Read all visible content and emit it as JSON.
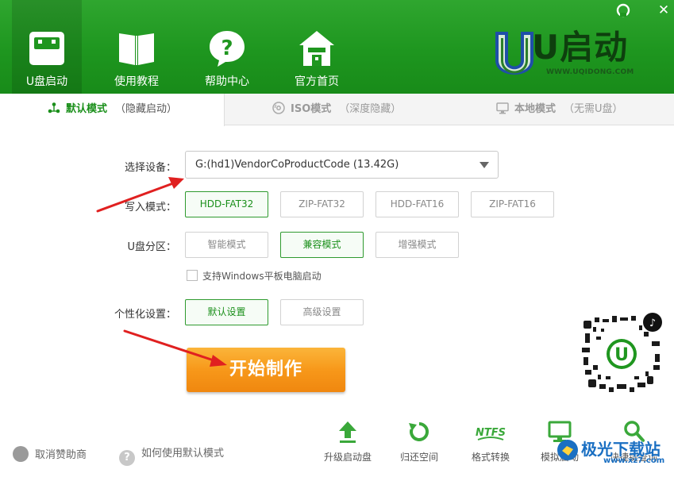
{
  "window": {
    "min_icon": "minimize-icon",
    "close_icon": "close-icon",
    "close_glyph": "✕"
  },
  "nav": [
    {
      "label": "U盘启动",
      "icon": "usb-drive-icon",
      "active": true
    },
    {
      "label": "使用教程",
      "icon": "book-icon",
      "active": false
    },
    {
      "label": "帮助中心",
      "icon": "help-icon",
      "active": false
    },
    {
      "label": "官方首页",
      "icon": "home-icon",
      "active": false
    }
  ],
  "logo": {
    "text": "U启动",
    "url": "WWW.UQIDONG.COM"
  },
  "tabs": [
    {
      "name": "默认模式",
      "sub": "（隐藏启动）",
      "icon": "share-nodes-icon"
    },
    {
      "name": "ISO模式",
      "sub": "（深度隐藏）",
      "icon": "disc-icon"
    },
    {
      "name": "本地模式",
      "sub": "（无需U盘）",
      "icon": "monitor-icon"
    }
  ],
  "form": {
    "device_label": "选择设备：",
    "device_value": "G:(hd1)VendorCoProductCode (13.42G)",
    "write_mode_label": "写入模式：",
    "write_modes": [
      "HDD-FAT32",
      "ZIP-FAT32",
      "HDD-FAT16",
      "ZIP-FAT16"
    ],
    "partition_label": "U盘分区：",
    "partitions": [
      "智能模式",
      "兼容模式",
      "增强模式"
    ],
    "tablet_checkbox_label": "支持Windows平板电脑启动",
    "personalize_label": "个性化设置：",
    "personalize_options": [
      "默认设置",
      "高级设置"
    ],
    "start_button": "开始制作"
  },
  "footer": {
    "cancel_sponsor": "取消赞助商",
    "how_to_use": "如何使用默认模式",
    "tools": [
      {
        "label": "升级启动盘",
        "icon": "upload-arrow-icon"
      },
      {
        "label": "归还空间",
        "icon": "restore-icon"
      },
      {
        "label": "格式转换",
        "icon": "ntfs-icon"
      },
      {
        "label": "模拟启动",
        "icon": "computer-icon"
      },
      {
        "label": "快捷键查询",
        "icon": "search-icon"
      }
    ]
  },
  "watermark": {
    "text": "极光下载站",
    "url": "www.xz7.com"
  },
  "colors": {
    "header_green": "#1e961f",
    "accent_green": "#1a8f1a",
    "start_orange": "#f7981a",
    "arrow_red": "#e02020"
  }
}
